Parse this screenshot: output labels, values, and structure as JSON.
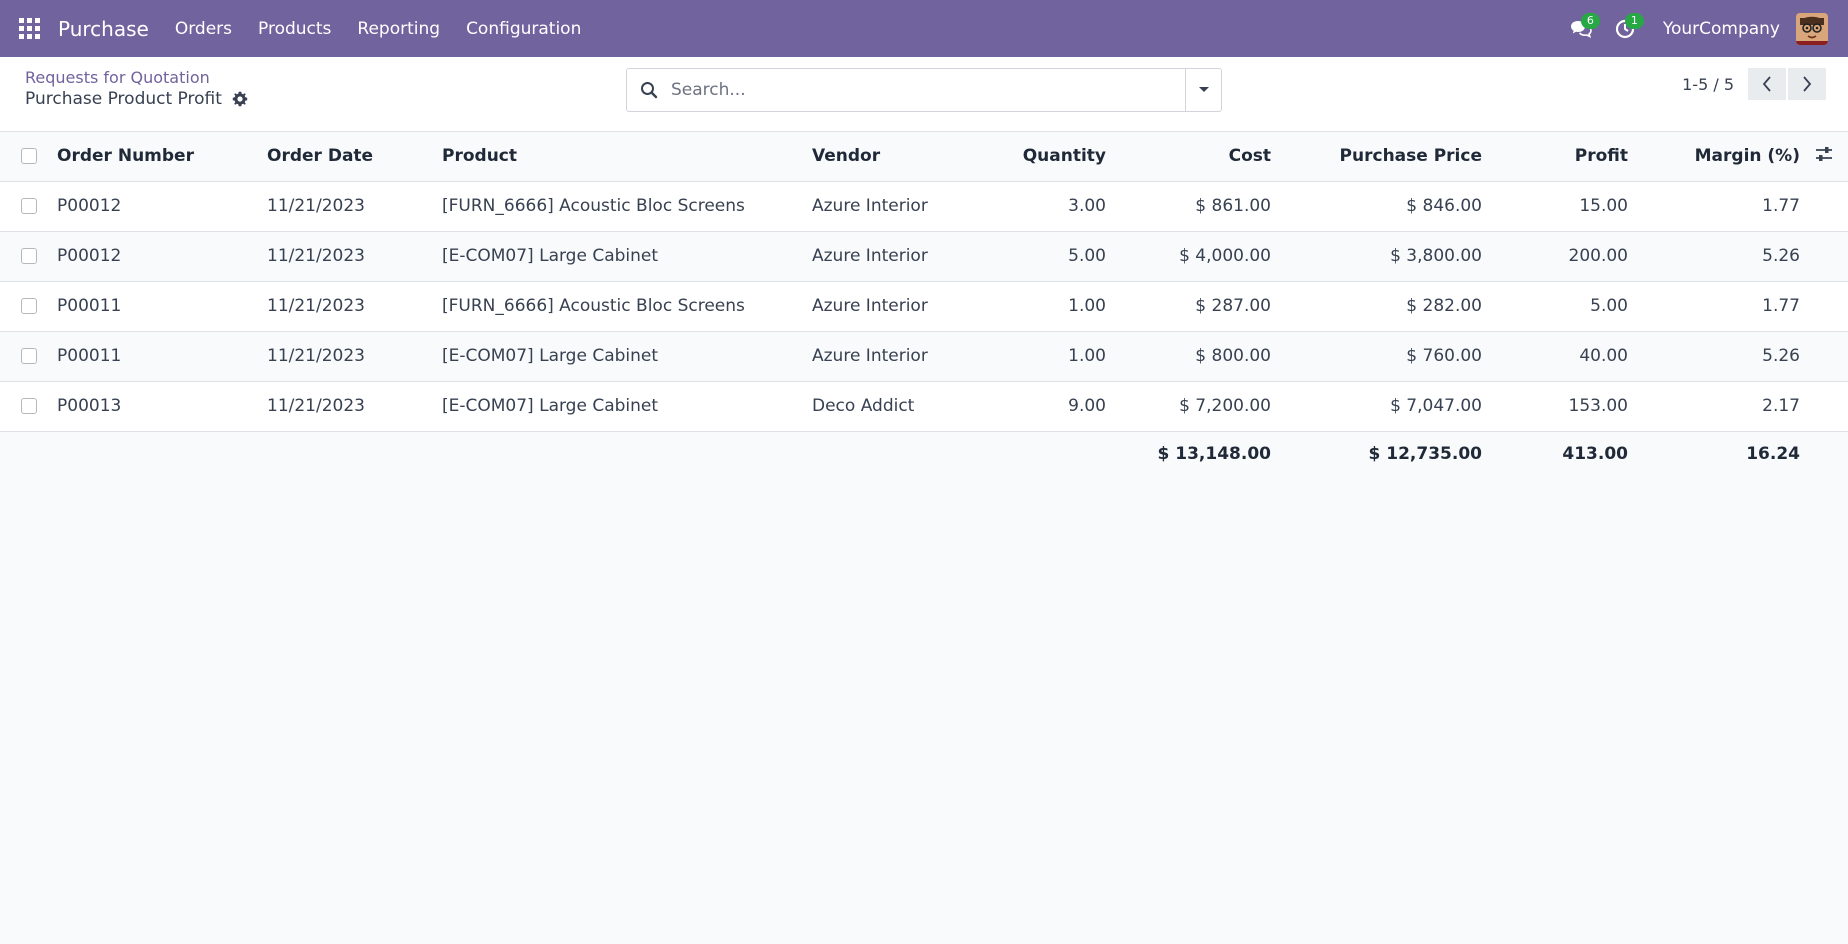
{
  "navbar": {
    "app_name": "Purchase",
    "menu": [
      "Orders",
      "Products",
      "Reporting",
      "Configuration"
    ],
    "messages_count": "6",
    "activities_count": "1",
    "company": "YourCompany"
  },
  "control": {
    "breadcrumb_parent": "Requests for Quotation",
    "breadcrumb_current": "Purchase Product Profit",
    "search_placeholder": "Search...",
    "pager": "1-5 / 5"
  },
  "table": {
    "headers": {
      "order_number": "Order Number",
      "order_date": "Order Date",
      "product": "Product",
      "vendor": "Vendor",
      "quantity": "Quantity",
      "cost": "Cost",
      "purchase_price": "Purchase Price",
      "profit": "Profit",
      "margin": "Margin (%)"
    },
    "rows": [
      {
        "order": "P00012",
        "date": "11/21/2023",
        "product": "[FURN_6666] Acoustic Bloc Screens",
        "vendor": "Azure Interior",
        "qty": "3.00",
        "cost": "$ 861.00",
        "price": "$ 846.00",
        "profit": "15.00",
        "margin": "1.77"
      },
      {
        "order": "P00012",
        "date": "11/21/2023",
        "product": "[E-COM07] Large Cabinet",
        "vendor": "Azure Interior",
        "qty": "5.00",
        "cost": "$ 4,000.00",
        "price": "$ 3,800.00",
        "profit": "200.00",
        "margin": "5.26"
      },
      {
        "order": "P00011",
        "date": "11/21/2023",
        "product": "[FURN_6666] Acoustic Bloc Screens",
        "vendor": "Azure Interior",
        "qty": "1.00",
        "cost": "$ 287.00",
        "price": "$ 282.00",
        "profit": "5.00",
        "margin": "1.77"
      },
      {
        "order": "P00011",
        "date": "11/21/2023",
        "product": "[E-COM07] Large Cabinet",
        "vendor": "Azure Interior",
        "qty": "1.00",
        "cost": "$ 800.00",
        "price": "$ 760.00",
        "profit": "40.00",
        "margin": "5.26"
      },
      {
        "order": "P00013",
        "date": "11/21/2023",
        "product": "[E-COM07] Large Cabinet",
        "vendor": "Deco Addict",
        "qty": "9.00",
        "cost": "$ 7,200.00",
        "price": "$ 7,047.00",
        "profit": "153.00",
        "margin": "2.17"
      }
    ],
    "totals": {
      "cost": "$ 13,148.00",
      "price": "$ 12,735.00",
      "profit": "413.00",
      "margin": "16.24"
    }
  }
}
